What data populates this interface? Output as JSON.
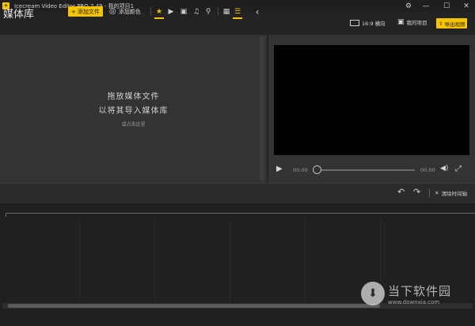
{
  "window": {
    "title": "Icecream Video Editor PRO 2.49 - 我的项目1",
    "logo_glyph": "✦",
    "settings_icon": "⚙",
    "minimize_icon": "—",
    "maximize_icon": "☐",
    "close_icon": "✕"
  },
  "toolbar": {
    "library_title": "媒体库",
    "add_file_label": "添加文件",
    "add_file_icon": "+",
    "add_color_label": "添加颜色",
    "add_color_icon": "◎",
    "filter_star_icon": "★",
    "filter_video_icon": "▶",
    "filter_image_icon": "▣",
    "filter_music_icon": "♫",
    "search_icon": "⚲",
    "grid_view_icon": "▦",
    "list_view_icon": "☰",
    "collapse_icon": "‹"
  },
  "preview_header": {
    "aspect_label": "16:9 横向",
    "project_label": "我的项目",
    "project_icon": "▣",
    "export_label": "导出视频",
    "export_icon": "⇧"
  },
  "media_library": {
    "empty_line1": "拖放媒体文件",
    "empty_line2": "以将其导入媒体库",
    "empty_line3": "或点击这里"
  },
  "player": {
    "play_icon": "▶",
    "time_current": "00:00",
    "time_total": "00:00",
    "progress": 0.0,
    "volume_icon": "◀)",
    "fullscreen_icon": "⤢"
  },
  "timeline_bar": {
    "undo_icon": "↶",
    "redo_icon": "↷",
    "clear_icon": "✕",
    "clear_label": "清除时间轴"
  },
  "watermark": {
    "glyph": "⬇",
    "main": "当下软件园",
    "sub": "www.downxia.com"
  },
  "colors": {
    "accent": "#f5c400",
    "bg": "#2b2b2b",
    "panel": "#333333",
    "video": "#000000"
  }
}
